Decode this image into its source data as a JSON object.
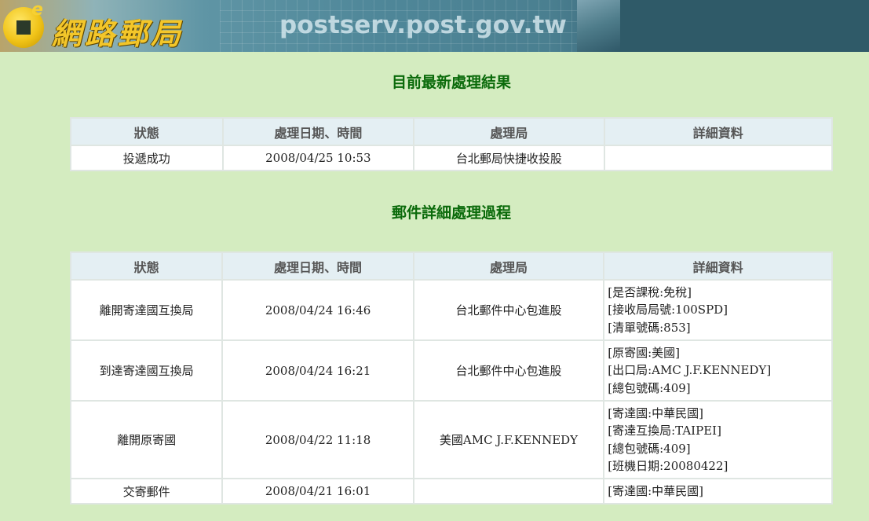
{
  "banner": {
    "logo_text": "網路郵局",
    "logo_e": "e",
    "url": "postserv.post.gov.tw"
  },
  "latest": {
    "title": "目前最新處理結果",
    "headers": [
      "狀態",
      "處理日期、時間",
      "處理局",
      "詳細資料"
    ],
    "row": {
      "status": "投遞成功",
      "datetime": "2008/04/25 10:53",
      "office": "台北郵局快捷收投股",
      "details": []
    }
  },
  "history": {
    "title": "郵件詳細處理過程",
    "headers": [
      "狀態",
      "處理日期、時間",
      "處理局",
      "詳細資料"
    ],
    "rows": [
      {
        "status": "離開寄達國互換局",
        "datetime": "2008/04/24 16:46",
        "office": "台北郵件中心包進股",
        "details": [
          "[是否課稅:免稅]",
          "[接收局局號:100SPD]",
          "[清單號碼:853]"
        ]
      },
      {
        "status": "到達寄達國互換局",
        "datetime": "2008/04/24 16:21",
        "office": "台北郵件中心包進股",
        "details": [
          "[原寄國:美國]",
          "[出口局:AMC J.F.KENNEDY]",
          "[總包號碼:409]"
        ]
      },
      {
        "status": "離開原寄國",
        "datetime": "2008/04/22 11:18",
        "office": "美國AMC J.F.KENNEDY",
        "details": [
          "[寄達國:中華民國]",
          "[寄達互換局:TAIPEI]",
          "[總包號碼:409]",
          "[班機日期:20080422]"
        ]
      },
      {
        "status": "交寄郵件",
        "datetime": "2008/04/21 16:01",
        "office": "",
        "details": [
          "[寄達國:中華民國]"
        ]
      }
    ]
  }
}
